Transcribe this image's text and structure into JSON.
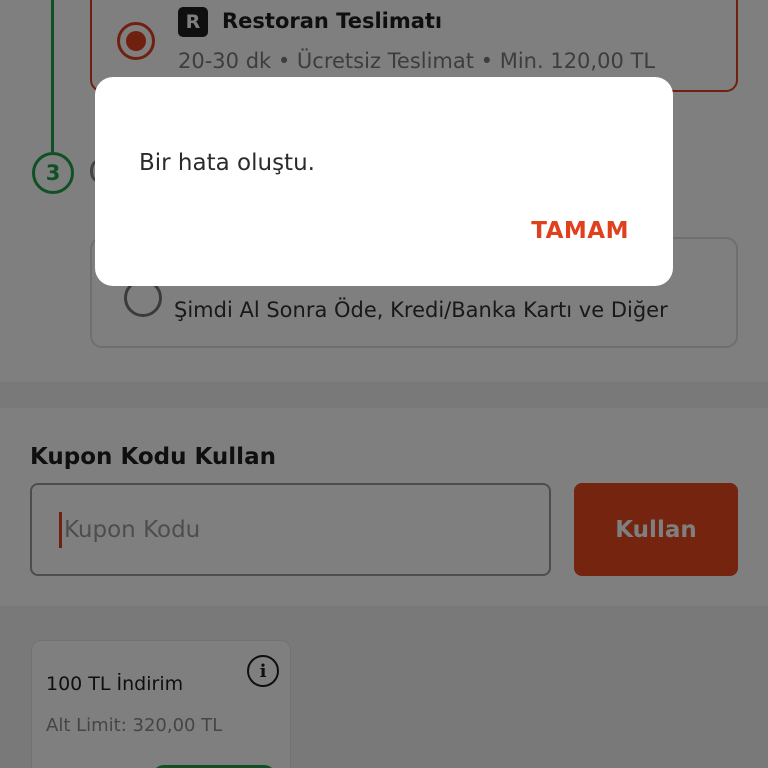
{
  "checkout": {
    "delivery_option": {
      "badge": "R",
      "title": "Restoran Teslimatı",
      "details": "20-30 dk • Ücretsiz Teslimat • Min. 120,00 TL"
    },
    "step_number": "3",
    "payment_option": {
      "description": "Şimdi Al Sonra Öde, Kredi/Banka Kartı ve Diğer"
    }
  },
  "coupon": {
    "title": "Kupon Kodu Kullan",
    "placeholder": "Kupon Kodu",
    "apply_label": "Kullan"
  },
  "discount_card": {
    "title": "100 TL İndirim",
    "min_limit": "Alt Limit: 320,00 TL"
  },
  "dialog": {
    "message": "Bir hata oluştu.",
    "ok_label": "TAMAM"
  },
  "colors": {
    "accent": "#e0401d",
    "success": "#1ea34a",
    "overlay": "rgba(0,0,0,0.5)"
  },
  "icons": {
    "info": "info-icon",
    "restaurant_badge": "restaurant-badge-icon"
  }
}
